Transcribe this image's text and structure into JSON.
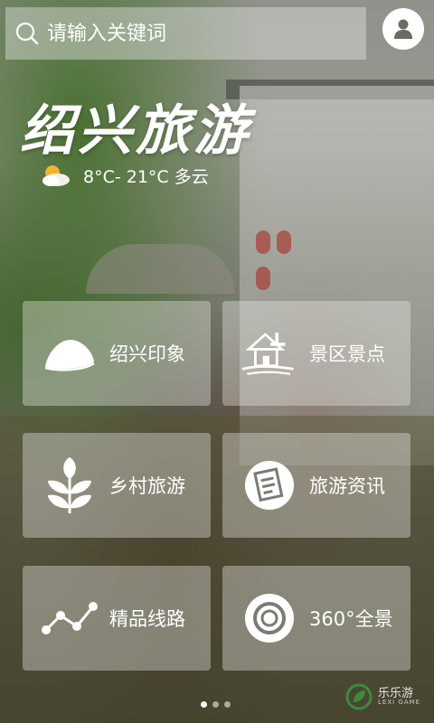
{
  "search": {
    "placeholder": "请输入关键词"
  },
  "title": "绍兴旅游",
  "weather": {
    "text": "8°C- 21°C 多云",
    "icon": "partly-cloudy-sun-icon"
  },
  "tiles": [
    {
      "label": "绍兴印象",
      "icon": "stone-icon"
    },
    {
      "label": "景区景点",
      "icon": "house-icon"
    },
    {
      "label": "乡村旅游",
      "icon": "leaf-icon"
    },
    {
      "label": "旅游资讯",
      "icon": "news-icon"
    },
    {
      "label": "精品线路",
      "icon": "route-icon"
    },
    {
      "label": "360°全景",
      "icon": "panorama-icon"
    }
  ],
  "pager": {
    "pages": 3,
    "current": 1
  },
  "watermark": {
    "name": "乐乐游",
    "sub": "LEXI GAME"
  },
  "colors": {
    "tile_bg": "#EBEBE8",
    "text": "#FFFFFF",
    "watermark_green": "#3C8A3A"
  }
}
